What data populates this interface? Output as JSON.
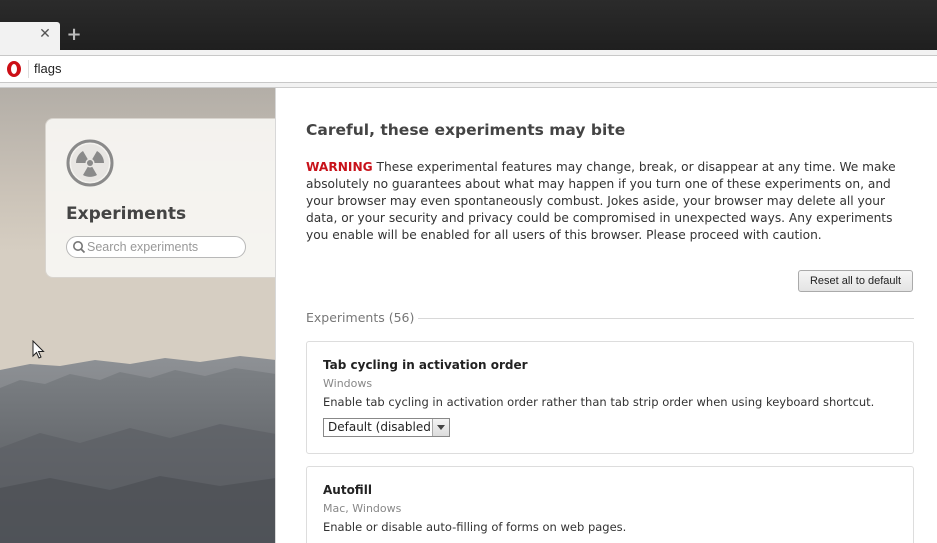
{
  "browser": {
    "tab_close_icon": "close-icon",
    "new_tab_icon": "plus-icon",
    "address": "flags",
    "logo_color": "#cc0f16"
  },
  "sidebar": {
    "title": "Experiments",
    "search_placeholder": "Search experiments",
    "icon": "radiation-icon"
  },
  "main": {
    "heading": "Careful, these experiments may bite",
    "warning_label": "WARNING",
    "warning_text": " These experimental features may change, break, or disappear at any time. We make absolutely no guarantees about what may happen if you turn one of these experiments on, and your browser may even spontaneously combust. Jokes aside, your browser may delete all your data, or your security and privacy could be compromised in unexpected ways. Any experiments you enable will be enabled for all users of this browser. Please proceed with caution.",
    "reset_label": "Reset all to default",
    "experiments_count": "Experiments (56)",
    "experiments": [
      {
        "name": "Tab cycling in activation order",
        "platforms": "Windows",
        "description": "Enable tab cycling in activation order rather than tab strip order when using keyboard shortcut.",
        "value": "Default (disabled)"
      },
      {
        "name": "Autofill",
        "platforms": "Mac, Windows",
        "description": "Enable or disable auto-filling of forms on web pages.",
        "value": ""
      }
    ]
  },
  "colors": {
    "warning": "#c8121a",
    "tabstrip": "#2b2b2b"
  }
}
